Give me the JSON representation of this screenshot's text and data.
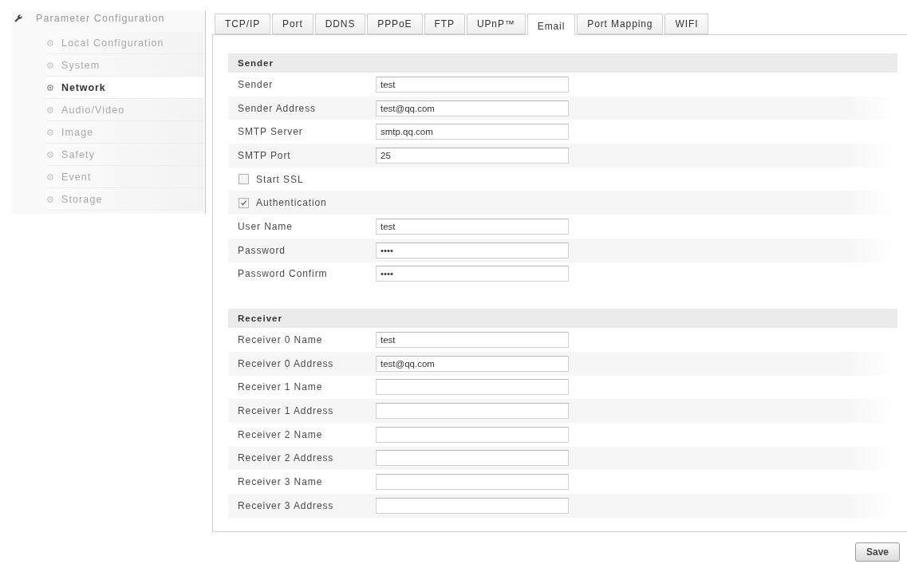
{
  "sidebar": {
    "title": "Parameter Configuration",
    "items": [
      {
        "label": "Local Configuration",
        "selected": false
      },
      {
        "label": "System",
        "selected": false
      },
      {
        "label": "Network",
        "selected": true
      },
      {
        "label": "Audio/Video",
        "selected": false
      },
      {
        "label": "Image",
        "selected": false
      },
      {
        "label": "Safety",
        "selected": false
      },
      {
        "label": "Event",
        "selected": false
      },
      {
        "label": "Storage",
        "selected": false
      }
    ]
  },
  "tabs": [
    {
      "label": "TCP/IP",
      "selected": false
    },
    {
      "label": "Port",
      "selected": false
    },
    {
      "label": "DDNS",
      "selected": false
    },
    {
      "label": "PPPoE",
      "selected": false
    },
    {
      "label": "FTP",
      "selected": false
    },
    {
      "label": "UPnP™",
      "selected": false
    },
    {
      "label": "Email",
      "selected": true
    },
    {
      "label": "Port Mapping",
      "selected": false
    },
    {
      "label": "WIFI",
      "selected": false
    }
  ],
  "sections": [
    {
      "title": "Sender",
      "rows": [
        {
          "kind": "field",
          "label": "Sender",
          "value": "test"
        },
        {
          "kind": "field",
          "label": "Sender Address",
          "value": "test@qq.com"
        },
        {
          "kind": "field",
          "label": "SMTP Server",
          "value": "smtp.qq.com"
        },
        {
          "kind": "field",
          "label": "SMTP Port",
          "value": "25"
        },
        {
          "kind": "checkbox",
          "label": "Start SSL",
          "checked": false
        },
        {
          "kind": "checkbox",
          "label": "Authentication",
          "checked": true
        },
        {
          "kind": "field",
          "label": "User Name",
          "value": "test"
        },
        {
          "kind": "field",
          "label": "Password",
          "value": "••••"
        },
        {
          "kind": "field",
          "label": "Password Confirm",
          "value": "••••"
        }
      ]
    },
    {
      "title": "Receiver",
      "rows": [
        {
          "kind": "field",
          "label": "Receiver 0 Name",
          "value": "test"
        },
        {
          "kind": "field",
          "label": "Receiver 0 Address",
          "value": "test@qq.com"
        },
        {
          "kind": "field",
          "label": "Receiver 1 Name"
        },
        {
          "kind": "field",
          "label": "Receiver 1 Address"
        },
        {
          "kind": "field",
          "label": "Receiver 2 Name"
        },
        {
          "kind": "field",
          "label": "Receiver 2 Address"
        },
        {
          "kind": "field",
          "label": "Receiver 3 Name"
        },
        {
          "kind": "field",
          "label": "Receiver 3 Address"
        }
      ]
    }
  ],
  "save_button": "Save"
}
